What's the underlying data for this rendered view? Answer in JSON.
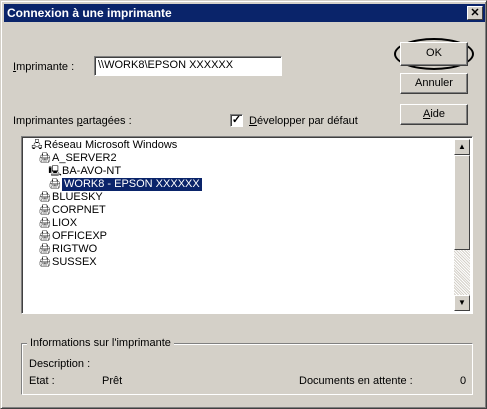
{
  "window": {
    "title": "Connexion à une imprimante",
    "close_symbol": "✕"
  },
  "printer": {
    "label_prefix": "",
    "label_underline": "I",
    "label_rest": "mprimante :",
    "value": "\\\\WORK8\\EPSON XXXXXX"
  },
  "shared": {
    "label_pre": "Imprimantes ",
    "label_underline": "p",
    "label_rest": "artagées :"
  },
  "expand": {
    "checked_mark": "✓",
    "label_underline": "D",
    "label_rest": "évelopper par défaut"
  },
  "buttons": {
    "ok": "OK",
    "cancel": "Annuler",
    "help_underline": "A",
    "help_rest": "ide"
  },
  "tree": [
    {
      "text": "Réseau Microsoft Windows",
      "icon": "network-icon",
      "glyph": "🖧",
      "level": 0
    },
    {
      "text": "A_SERVER2",
      "icon": "printer-icon",
      "glyph": "🖨",
      "level": 1
    },
    {
      "text": "BA-AVO-NT",
      "icon": "computer-icon",
      "glyph": "🖳",
      "level": 2
    },
    {
      "text": "WORK8 - EPSON XXXXXX",
      "icon": "printer-icon",
      "glyph": "🖨",
      "level": 2,
      "selected": true
    },
    {
      "text": "BLUESKY",
      "icon": "printer-icon",
      "glyph": "🖨",
      "level": 1
    },
    {
      "text": "CORPNET",
      "icon": "printer-icon",
      "glyph": "🖨",
      "level": 1
    },
    {
      "text": "LIOX",
      "icon": "printer-icon",
      "glyph": "🖨",
      "level": 1
    },
    {
      "text": "OFFICEXP",
      "icon": "printer-icon",
      "glyph": "🖨",
      "level": 1
    },
    {
      "text": "RIGTWO",
      "icon": "printer-icon",
      "glyph": "🖨",
      "level": 1
    },
    {
      "text": "SUSSEX",
      "icon": "printer-icon",
      "glyph": "🖨",
      "level": 1
    }
  ],
  "info": {
    "group_title": "Informations sur l'imprimante",
    "description_label": "Description :",
    "status_label": "Etat :",
    "status_value": "Prêt",
    "queue_label": "Documents en attente :",
    "queue_value": "0"
  },
  "scroll": {
    "up": "▲",
    "down": "▼"
  }
}
